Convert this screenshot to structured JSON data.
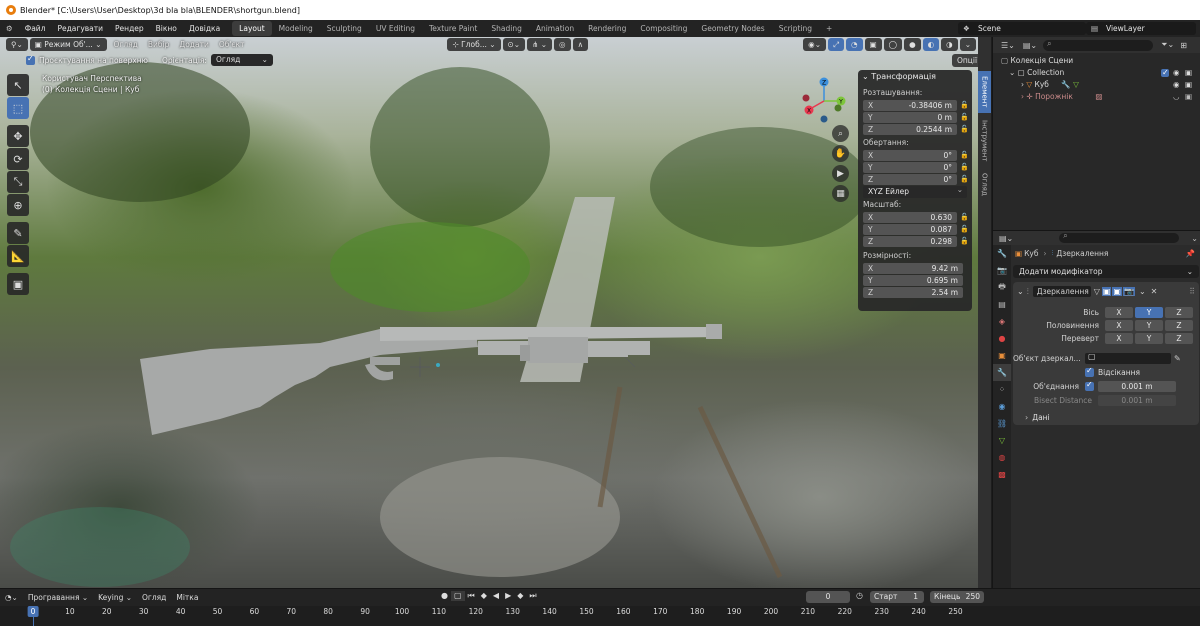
{
  "window": {
    "title": "Blender* [C:\\Users\\User\\Desktop\\3d bla bla\\BLENDER\\shortgun.blend]"
  },
  "menu": [
    "Файл",
    "Редагувати",
    "Рендер",
    "Вікно",
    "Довідка"
  ],
  "workspaces": [
    "Layout",
    "Modeling",
    "Sculpting",
    "UV Editing",
    "Texture Paint",
    "Shading",
    "Animation",
    "Rendering",
    "Compositing",
    "Geometry Nodes",
    "Scripting"
  ],
  "workspace_active": "Layout",
  "scene_name": "Scene",
  "view_layer": "ViewLayer",
  "viewport": {
    "mode": "Режим Об'...",
    "header_menus": [
      "Огляд",
      "Вибір",
      "Додати",
      "Об'єкт"
    ],
    "transform_orient": "Глоб...",
    "options": "Опції",
    "snap_label": "Проєктування на поверхню",
    "orientation_label": "Орієнтація:",
    "orientation_value": "Огляд",
    "view_name": "Користувач Перспектива",
    "collection_info": "(0) Колекція Сцени | Куб"
  },
  "gizmo": {
    "x": "X",
    "y": "Y",
    "z": "Z"
  },
  "transform_panel": {
    "title": "Трансформація",
    "location_label": "Розташування:",
    "location": [
      {
        "axis": "X",
        "value": "-0.38406 m"
      },
      {
        "axis": "Y",
        "value": "0 m"
      },
      {
        "axis": "Z",
        "value": "0.2544 m"
      }
    ],
    "rotation_label": "Обертання:",
    "rotation": [
      {
        "axis": "X",
        "value": "0°"
      },
      {
        "axis": "Y",
        "value": "0°"
      },
      {
        "axis": "Z",
        "value": "0°"
      }
    ],
    "rotation_mode": "XYZ Ейлер",
    "scale_label": "Масштаб:",
    "scale": [
      {
        "axis": "X",
        "value": "0.630"
      },
      {
        "axis": "Y",
        "value": "0.087"
      },
      {
        "axis": "Z",
        "value": "0.298"
      }
    ],
    "dimensions_label": "Розмірності:",
    "dimensions": [
      {
        "axis": "X",
        "value": "9.42 m"
      },
      {
        "axis": "Y",
        "value": "0.695 m"
      },
      {
        "axis": "Z",
        "value": "2.54 m"
      }
    ]
  },
  "sidebar_tabs": [
    "Елемент",
    "Інструмент",
    "Огляд"
  ],
  "outliner": {
    "scene_collection": "Колекція Сцени",
    "collection": "Collection",
    "items": [
      "Куб",
      "Порожнік"
    ]
  },
  "properties": {
    "object_name": "Куб",
    "modifier_name_header": "Дзеркалення",
    "add_modifier": "Додати модифікатор",
    "modifier_name": "Дзеркалення",
    "axis_label": "Вісь",
    "bisect_label": "Половинення",
    "flip_label": "Переверт",
    "axes": [
      "X",
      "Y",
      "Z"
    ],
    "mirror_object_label": "Об'єкт дзеркал...",
    "clipping_label": "Відсікання",
    "merge_label": "Об'єднання",
    "merge_value": "0.001 m",
    "bisect_distance_label": "Bisect Distance",
    "bisect_distance_value": "0.001 m",
    "data_label": "Дані"
  },
  "timeline": {
    "playback": "Програвання",
    "keying": "Keying",
    "view": "Огляд",
    "marker": "Мітка",
    "current_frame": "0",
    "start_label": "Старт",
    "start": "1",
    "end_label": "Кінець",
    "end": "250",
    "ruler": [
      "0",
      "10",
      "20",
      "30",
      "40",
      "50",
      "60",
      "70",
      "80",
      "90",
      "100",
      "110",
      "120",
      "130",
      "140",
      "150",
      "160",
      "170",
      "180",
      "190",
      "200",
      "210",
      "220",
      "230",
      "240",
      "250"
    ]
  },
  "colors": {
    "accent": "#4772b3",
    "x_axis": "#e8384f",
    "y_axis": "#7ec63b",
    "z_axis": "#3b8fdc",
    "modifier_icon": "#5b9bd5"
  }
}
